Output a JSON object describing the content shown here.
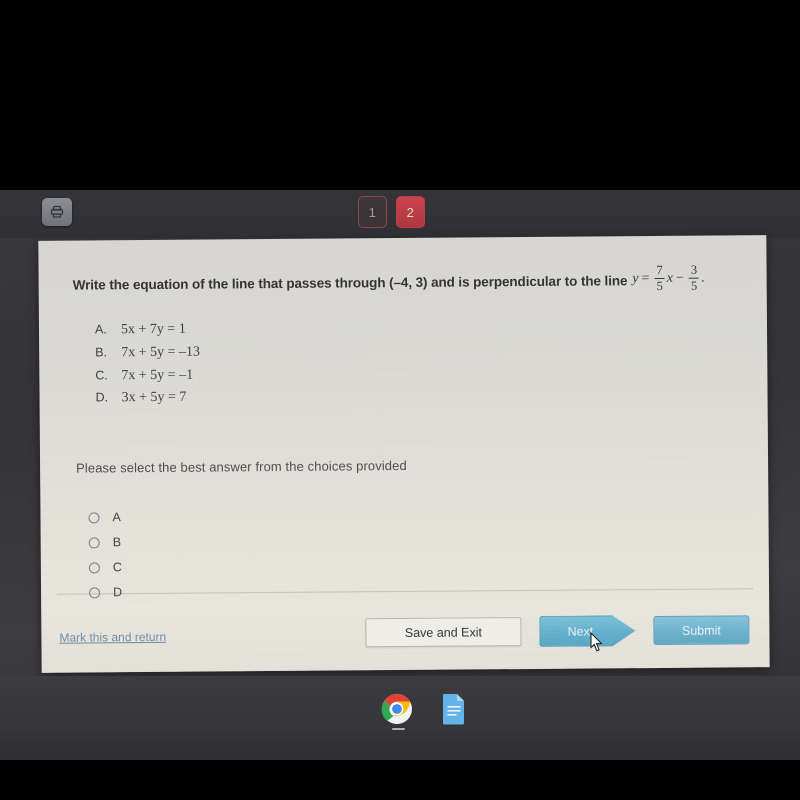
{
  "app": {
    "tabbar": {
      "print_icon": "printer-icon",
      "tabs": [
        {
          "label": "1",
          "state": "inactive"
        },
        {
          "label": "2",
          "state": "active"
        }
      ],
      "next_arrow_icon": "chevron-right-icon"
    }
  },
  "question": {
    "stem_before_math": "Write the equation of the line that passes through (–4, 3) and is perpendicular to the line",
    "math": {
      "lhs": "y",
      "equals": "=",
      "term1_numerator": "7",
      "term1_denominator": "5",
      "variable": "x",
      "operator": "−",
      "term2_numerator": "3",
      "term2_denominator": "5",
      "period": "."
    },
    "choices": [
      {
        "letter": "A.",
        "equation": "5x + 7y = 1"
      },
      {
        "letter": "B.",
        "equation": "7x + 5y = –13"
      },
      {
        "letter": "C.",
        "equation": "7x + 5y = –1"
      },
      {
        "letter": "D.",
        "equation": "3x + 5y = 7"
      }
    ],
    "instruction": "Please select the best answer from the choices provided",
    "options": [
      {
        "label": "A",
        "selected": false
      },
      {
        "label": "B",
        "selected": false
      },
      {
        "label": "C",
        "selected": false
      },
      {
        "label": "D",
        "selected": false
      }
    ]
  },
  "footer": {
    "save_and_exit_label": "Save and Exit",
    "next_label": "Next",
    "submit_label": "Submit",
    "mark_link_label": "Mark this and return"
  },
  "taskbar": {
    "items": [
      {
        "name": "chrome-icon"
      },
      {
        "name": "google-docs-icon"
      }
    ]
  },
  "colors": {
    "tab_active": "#c8444c",
    "button_blue": "#62b0cd",
    "link_blue": "#6d8fa8",
    "panel_bg": "#e0ded7"
  }
}
